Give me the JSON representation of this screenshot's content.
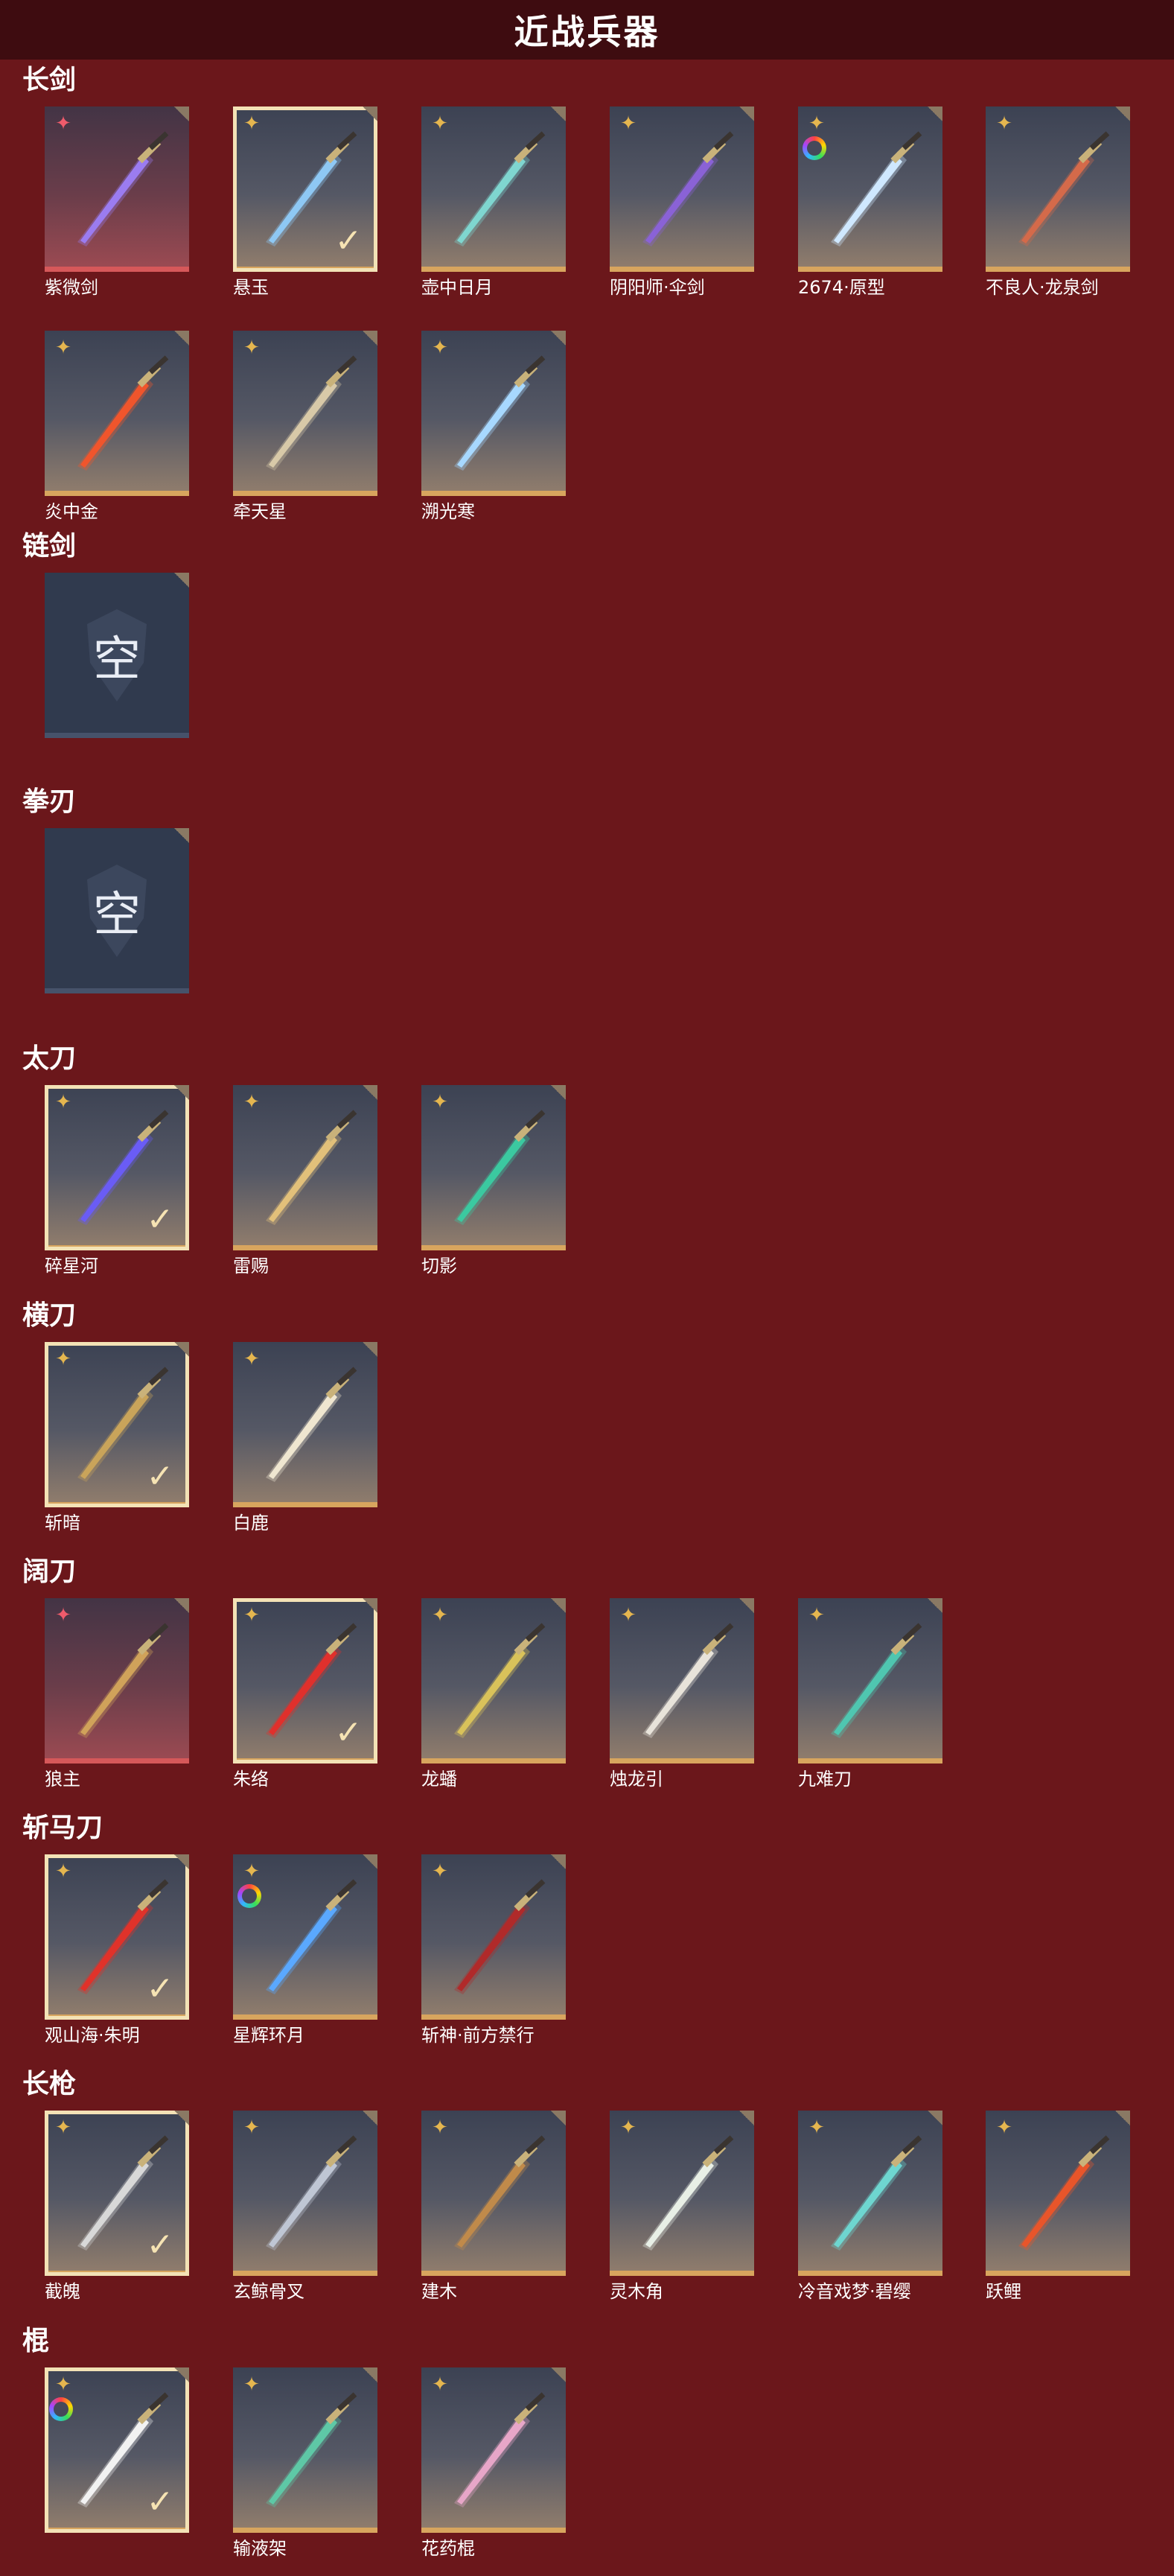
{
  "title": "近战兵器",
  "colors": {
    "background": "#6b171b",
    "header": "#3e0c10",
    "gold_border": "#d8a55e",
    "red_border": "#d6585a",
    "selected_frame": "#f3e2b6"
  },
  "sections": [
    {
      "title": "长剑",
      "items": [
        {
          "name": "紫微剑",
          "rarity": "red-star-icon",
          "selected": false,
          "accent": "#9b7cf0"
        },
        {
          "name": "悬玉",
          "rarity": "gold-star-icon",
          "selected": true,
          "accent": "#8ec8f4"
        },
        {
          "name": "壶中日月",
          "rarity": "gold-star-icon",
          "selected": false,
          "accent": "#7fd6d0"
        },
        {
          "name": "阴阳师·伞剑",
          "rarity": "gold-star-icon",
          "selected": false,
          "accent": "#8a62d6"
        },
        {
          "name": "2674·原型",
          "rarity": "gold-star-icon",
          "selected": false,
          "accent": "#cfe8ff",
          "dye": true
        },
        {
          "name": "不良人·龙泉剑",
          "rarity": "gold-star-icon",
          "selected": false,
          "accent": "#d46a4a"
        },
        {
          "name": "炎中金",
          "rarity": "gold-star-icon",
          "selected": false,
          "accent": "#f0552c"
        },
        {
          "name": "牵天星",
          "rarity": "gold-star-icon",
          "selected": false,
          "accent": "#d8c9a8"
        },
        {
          "name": "溯光寒",
          "rarity": "gold-star-icon",
          "selected": false,
          "accent": "#a7d8ff"
        }
      ]
    },
    {
      "title": "链剑",
      "items": [
        {
          "name": "",
          "empty": true,
          "empty_text": "空"
        }
      ]
    },
    {
      "title": "拳刃",
      "items": [
        {
          "name": "",
          "empty": true,
          "empty_text": "空"
        }
      ]
    },
    {
      "title": "太刀",
      "items": [
        {
          "name": "碎星河",
          "rarity": "gold-star-icon",
          "selected": true,
          "accent": "#6a5cf5"
        },
        {
          "name": "雷赐",
          "rarity": "gold-star-icon",
          "selected": false,
          "accent": "#e2c07a"
        },
        {
          "name": "切影",
          "rarity": "gold-star-icon",
          "selected": false,
          "accent": "#3bc9a0"
        }
      ]
    },
    {
      "title": "横刀",
      "items": [
        {
          "name": "斩暗",
          "rarity": "gold-star-icon",
          "selected": true,
          "accent": "#c9a45a"
        },
        {
          "name": "白鹿",
          "rarity": "gold-star-icon",
          "selected": false,
          "accent": "#efe6d0"
        }
      ]
    },
    {
      "title": "阔刀",
      "items": [
        {
          "name": "狼主",
          "rarity": "red-star-icon",
          "selected": false,
          "accent": "#d0a25a"
        },
        {
          "name": "朱络",
          "rarity": "gold-star-icon",
          "selected": true,
          "accent": "#e0302c"
        },
        {
          "name": "龙蟠",
          "rarity": "gold-star-icon",
          "selected": false,
          "accent": "#d9c25a"
        },
        {
          "name": "烛龙引",
          "rarity": "gold-star-icon",
          "selected": false,
          "accent": "#e8e3da"
        },
        {
          "name": "九难刀",
          "rarity": "gold-star-icon",
          "selected": false,
          "accent": "#4fc6b0"
        }
      ]
    },
    {
      "title": "斩马刀",
      "items": [
        {
          "name": "观山海·朱明",
          "rarity": "gold-star-icon",
          "selected": true,
          "accent": "#e0322a"
        },
        {
          "name": "星辉环月",
          "rarity": "gold-star-icon",
          "selected": false,
          "accent": "#5aa8ff",
          "dye": true
        },
        {
          "name": "斩神·前方禁行",
          "rarity": "gold-star-icon",
          "selected": false,
          "accent": "#b02a2a"
        }
      ]
    },
    {
      "title": "长枪",
      "items": [
        {
          "name": "截魄",
          "rarity": "gold-star-icon",
          "selected": true,
          "accent": "#d8d8d8"
        },
        {
          "name": "玄鲸骨叉",
          "rarity": "gold-star-icon",
          "selected": false,
          "accent": "#bfc6d4"
        },
        {
          "name": "建木",
          "rarity": "gold-star-icon",
          "selected": false,
          "accent": "#c08a4a"
        },
        {
          "name": "灵木角",
          "rarity": "gold-star-icon",
          "selected": false,
          "accent": "#e8efe6"
        },
        {
          "name": "冷音戏梦·碧缨",
          "rarity": "gold-star-icon",
          "selected": false,
          "accent": "#6ed6d0"
        },
        {
          "name": "跃鲤",
          "rarity": "gold-star-icon",
          "selected": false,
          "accent": "#e8552a"
        }
      ]
    },
    {
      "title": "棍",
      "items": [
        {
          "name": "",
          "rarity": "gold-star-icon",
          "selected": true,
          "accent": "#f2f2f2",
          "dye": true
        },
        {
          "name": "输液架",
          "rarity": "gold-star-icon",
          "selected": false,
          "accent": "#5ec8a6"
        },
        {
          "name": "花药棍",
          "rarity": "gold-star-icon",
          "selected": false,
          "accent": "#e7a6c8"
        }
      ]
    }
  ]
}
